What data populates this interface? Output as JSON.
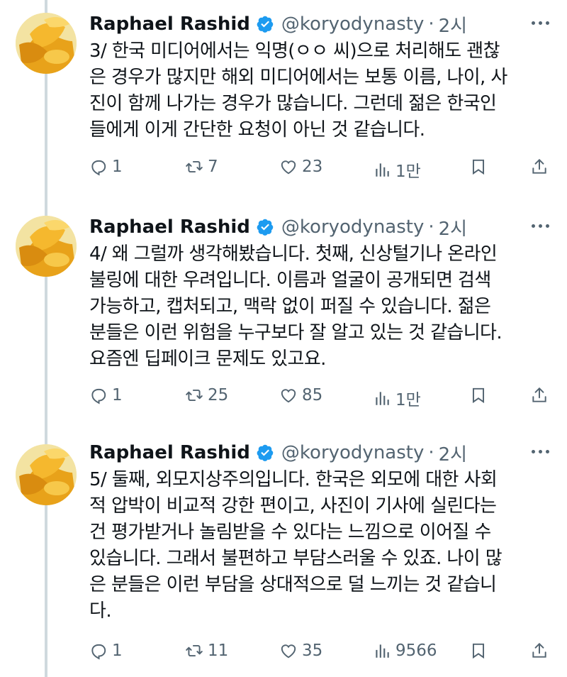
{
  "author": {
    "name": "Raphael Rashid",
    "handle": "@koryodynasty",
    "separator": "·"
  },
  "tweets": [
    {
      "time": "2시",
      "lines": [
        "3/ 한국 미디어에서는 익명(ㅇㅇ 씨)으로 처리해도 괜찮",
        "은 경우가 많지만 해외 미디어에서는 보통 이름, 나이, 사",
        "진이 함께 나가는 경우가 많습니다. 그런데 젊은 한국인",
        "들에게 이게 간단한 요청이 아닌 것 같습니다."
      ],
      "replies": "1",
      "retweets": "7",
      "likes": "23",
      "views": "1만"
    },
    {
      "time": "2시",
      "lines": [
        "4/ 왜 그럴까 생각해봤습니다. 첫째, 신상털기나 온라인",
        "불링에 대한 우려입니다. 이름과 얼굴이 공개되면 검색",
        "가능하고, 캡처되고, 맥락 없이 퍼질 수 있습니다. 젊은",
        "분들은 이런 위험을 누구보다 잘 알고 있는 것 같습니다.",
        "요즘엔 딥페이크 문제도 있고요."
      ],
      "replies": "1",
      "retweets": "25",
      "likes": "85",
      "views": "1만"
    },
    {
      "time": "2시",
      "lines": [
        "5/ 둘째, 외모지상주의입니다. 한국은 외모에 대한 사회",
        "적 압박이 비교적 강한 편이고, 사진이 기사에 실린다는",
        "건 평가받거나 놀림받을 수 있다는 느낌으로 이어질 수",
        "있습니다. 그래서 불편하고 부담스러울 수 있죠. 나이 많",
        "은 분들은 이런 부담을 상대적으로 덜 느끼는 것 같습니",
        "다."
      ],
      "replies": "1",
      "retweets": "11",
      "likes": "35",
      "views": "9566"
    }
  ],
  "colors": {
    "text": "#0f1419",
    "secondary": "#536471",
    "verified": "#1d9bf0",
    "thread_line": "#cfd9de"
  },
  "icons": [
    "verified-badge-icon",
    "more-icon",
    "reply-icon",
    "retweet-icon",
    "like-icon",
    "views-icon",
    "bookmark-icon",
    "share-icon"
  ]
}
